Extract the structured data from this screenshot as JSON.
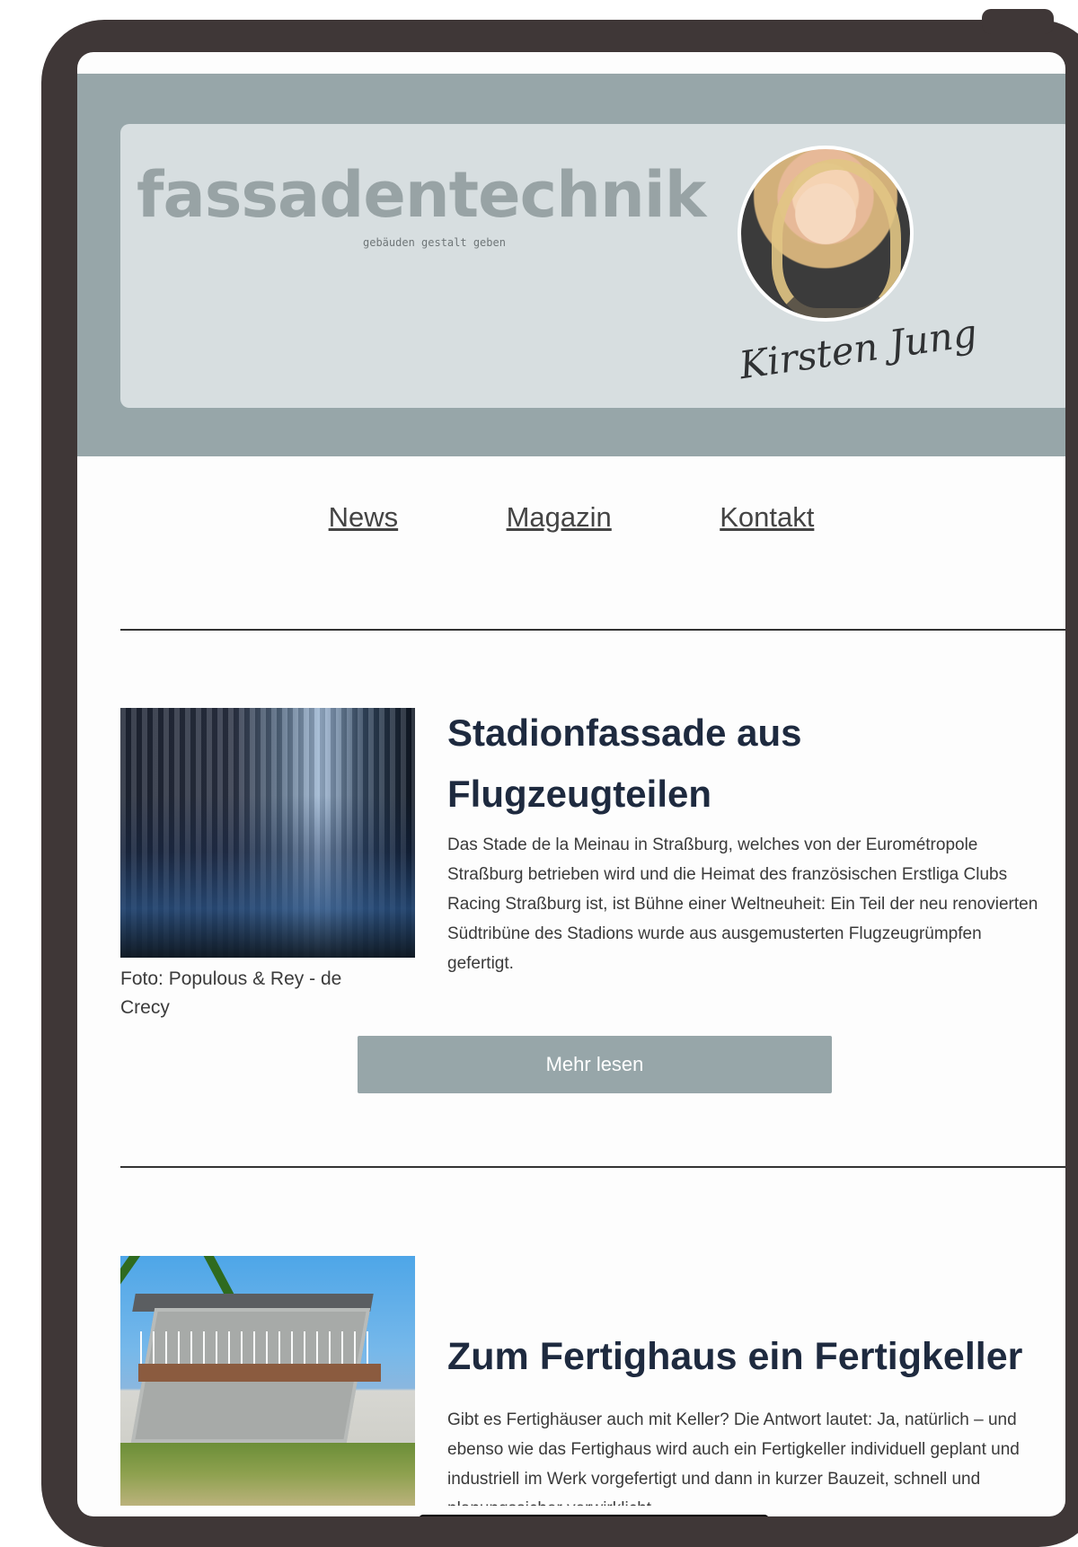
{
  "header": {
    "logo_text": "fassadentechnik",
    "tagline": "gebäuden gestalt geben",
    "signature": "Kirsten Jung"
  },
  "nav": {
    "items": [
      "News",
      "Magazin",
      "Kontakt"
    ]
  },
  "articles": [
    {
      "title_line1": "Stadionfassade aus",
      "title_line2": "Flugzeugteilen",
      "text": "Das Stade de la Meinau in Straßburg, welches von der Eurométropole Straßburg betrieben wird und die Heimat des französischen Erstliga Clubs Racing Straßburg ist, ist Bühne einer Weltneuheit: Ein Teil der neu renovierten Südtribüne des Stadions wurde aus ausgemusterten Flugzeugrümpfen gefertigt.",
      "caption": "Foto: Populous & Rey - de Crecy",
      "button": "Mehr lesen"
    },
    {
      "title": "Zum Fertighaus ein Fertigkeller",
      "text": "Gibt es Fertighäuser auch mit Keller? Die Antwort lautet: Ja, natürlich – und ebenso wie das Fertighaus wird auch ein Fertigkeller individuell geplant und industriell im Werk vorgefertigt und dann in kurzer Bauzeit, schnell und planungssicher verwirklicht."
    }
  ],
  "colors": {
    "frame": "#3f3737",
    "header_band": "#97a6a9",
    "header_card": "#d7dee0",
    "button": "#97a6a9",
    "headline": "#1e2a3f"
  }
}
